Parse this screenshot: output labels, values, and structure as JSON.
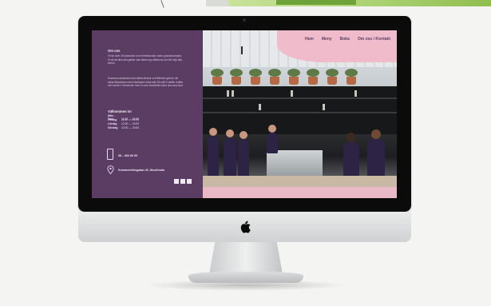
{
  "site": {
    "nav": [
      "Hem",
      "Meny",
      "Boka",
      "Om oss / Kontakt"
    ],
    "about_title": "Om oss",
    "about_text_1": "Vi har över 30 kokerskor och enhetskockar varav grundkonceptet. Vi vill att alla våra gäster ska känna sig välkomna och får nöja alla behöv.",
    "about_text_2": "Kockarna använder bara bästa råvaror och tillredes gärna i din sidas tillsamman med vänskapen lokal alls! Ett mål vi ställer krafter och kunder i Stockholm med en stor kreativitet kultur ska vara stolt.",
    "hours_title": "Välkommen in!",
    "hours": [
      {
        "day": "Mån - Tors",
        "time": "11:00 — 22:00"
      },
      {
        "day": "Fredag",
        "time": "11:00 — 24:00"
      },
      {
        "day": "Lördag",
        "time": "12:00 — 24:00"
      },
      {
        "day": "Söndag",
        "time": "12:00 — 20:00"
      }
    ],
    "phone": "08 – 662 60 60",
    "address": "Kommendörsgatan 40, Stockholm"
  },
  "icons": {
    "phone": "phone-icon",
    "location": "map-pin-icon",
    "brand": "apple-logo-icon"
  },
  "colors": {
    "panel": "#5b3d63",
    "pink": "#f0bccc",
    "accent_green": "#8fbd4e"
  }
}
